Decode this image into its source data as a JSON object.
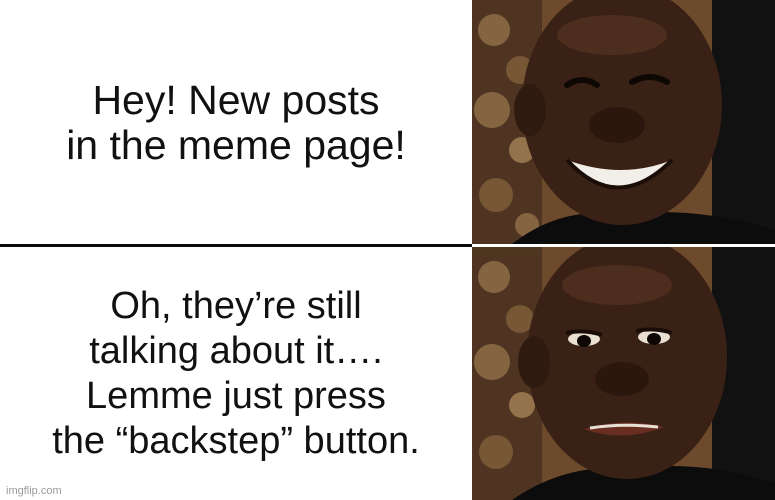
{
  "panels": {
    "top": {
      "caption": "Hey! New posts\nin the meme page!",
      "face_mood": "happy"
    },
    "bottom": {
      "caption": "Oh, they’re still\ntalking about it….\nLemme just press\nthe “backstep” button.",
      "face_mood": "disappointed"
    }
  },
  "watermark": "imgflip.com",
  "colors": {
    "skin": "#3a2116",
    "background_wall": "#6d4a2c",
    "ornament": "#8a6a45",
    "shirt": "#0c0c0c"
  }
}
